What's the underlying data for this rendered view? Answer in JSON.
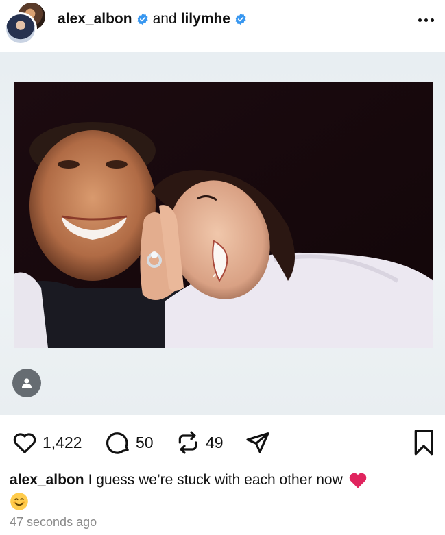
{
  "header": {
    "user1": "alex_albon",
    "and": "and",
    "user2": "lilymhe",
    "more_icon": "more-horizontal-icon"
  },
  "post": {
    "photo_alt": "polaroid photo of smiling couple showing ring",
    "tag_icon": "user-tag-icon"
  },
  "actions": {
    "likes": "1,422",
    "comments": "50",
    "reposts": "49",
    "icons": [
      "heart-icon",
      "comment-icon",
      "repost-icon",
      "share-icon",
      "bookmark-icon"
    ]
  },
  "caption": {
    "username": "alex_albon",
    "text": "I guess we’re stuck with each other now"
  },
  "timestamp": "47 seconds ago",
  "colors": {
    "verified": "#3897f0",
    "heart": "#e0245e",
    "timestamp": "#8a8a8a"
  }
}
